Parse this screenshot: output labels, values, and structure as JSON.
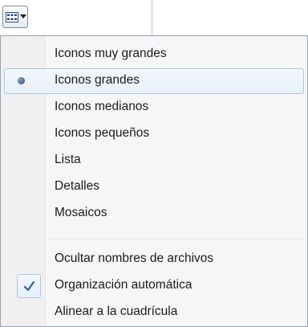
{
  "toolbar": {
    "view_button_icon": "grid-view-icon",
    "dropdown_icon": "chevron-down-icon"
  },
  "menu": {
    "items": [
      {
        "label": "Iconos muy grandes",
        "state": "none"
      },
      {
        "label": "Iconos grandes",
        "state": "radio-selected"
      },
      {
        "label": "Iconos medianos",
        "state": "none"
      },
      {
        "label": "Iconos pequeños",
        "state": "none"
      },
      {
        "label": "Lista",
        "state": "none"
      },
      {
        "label": "Detalles",
        "state": "none"
      },
      {
        "label": "Mosaicos",
        "state": "none"
      }
    ],
    "options": [
      {
        "label": "Ocultar nombres de archivos",
        "state": "unchecked"
      },
      {
        "label": "Organización automática",
        "state": "checked"
      },
      {
        "label": "Alinear a la cuadrícula",
        "state": "unchecked"
      }
    ]
  },
  "colors": {
    "selection_border": "#aac6e8",
    "menu_background": "#f5f6f7",
    "bullet": "#2c3f74",
    "check": "#2f5fae"
  }
}
